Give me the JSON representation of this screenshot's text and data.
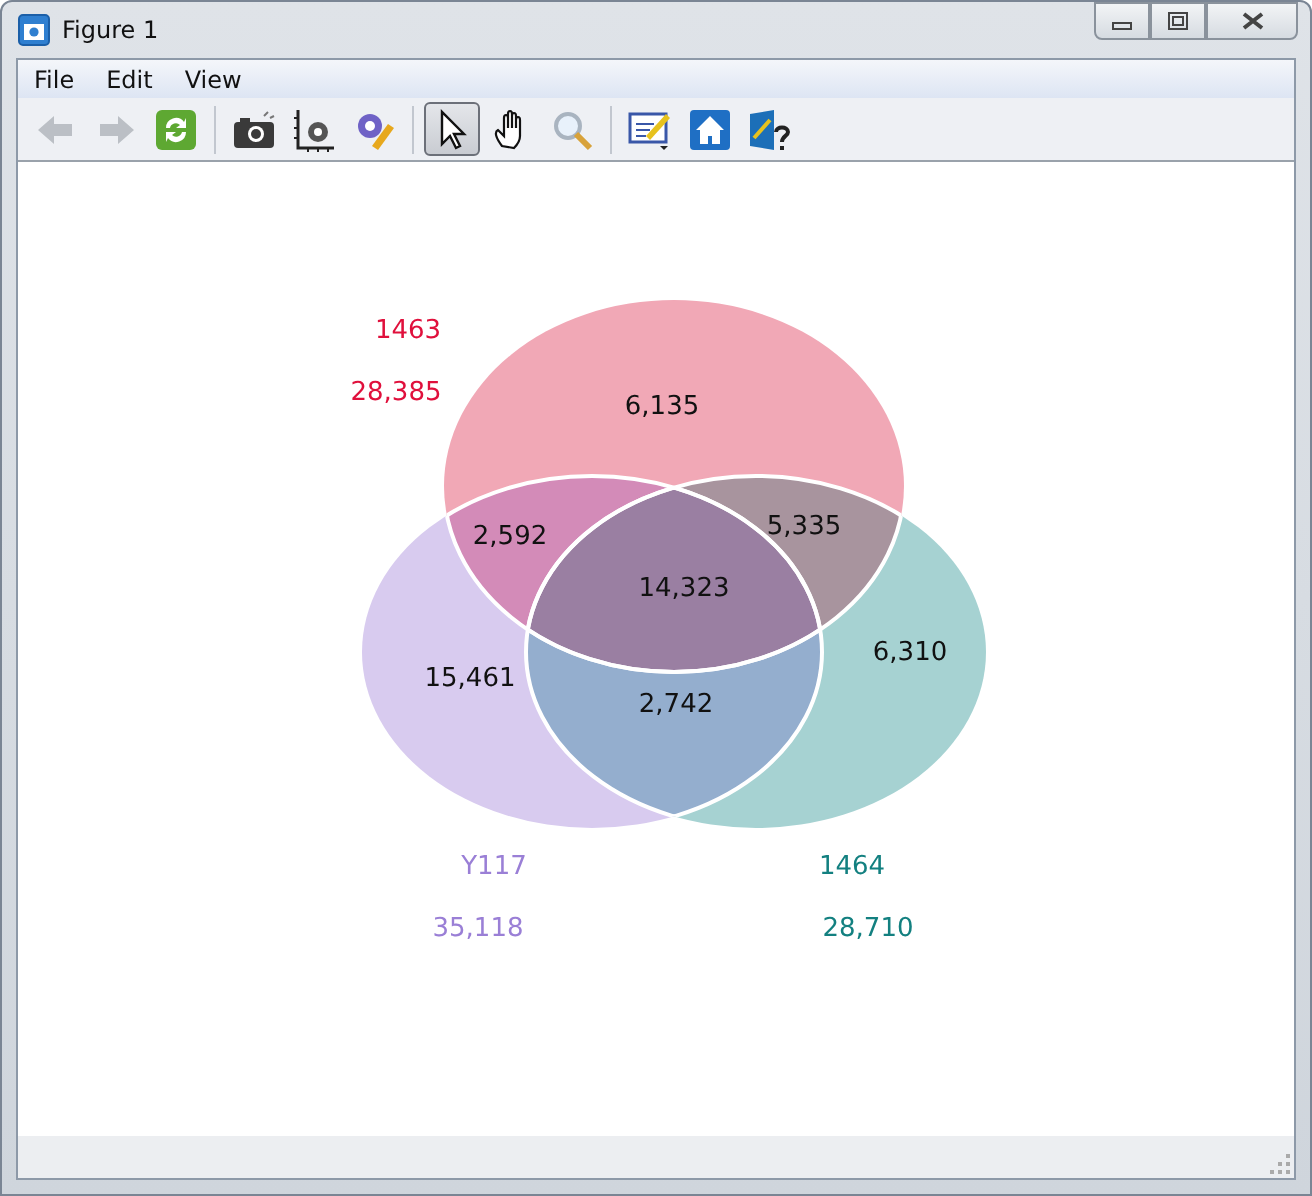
{
  "window": {
    "title": "Figure 1"
  },
  "menu": [
    "File",
    "Edit",
    "View"
  ],
  "toolbar": [
    {
      "kind": "back",
      "selected": false,
      "disabled": true
    },
    {
      "kind": "forward",
      "selected": false,
      "disabled": true
    },
    {
      "kind": "refresh",
      "selected": false,
      "disabled": false
    },
    {
      "kind": "sep"
    },
    {
      "kind": "camera",
      "selected": false,
      "disabled": false
    },
    {
      "kind": "axes",
      "selected": false,
      "disabled": false
    },
    {
      "kind": "wrench",
      "selected": false,
      "disabled": false
    },
    {
      "kind": "sep"
    },
    {
      "kind": "pointer",
      "selected": true,
      "disabled": false
    },
    {
      "kind": "hand",
      "selected": false,
      "disabled": false
    },
    {
      "kind": "zoom",
      "selected": false,
      "disabled": false
    },
    {
      "kind": "sep"
    },
    {
      "kind": "edit",
      "selected": false,
      "disabled": false
    },
    {
      "kind": "home",
      "selected": false,
      "disabled": false
    },
    {
      "kind": "help",
      "selected": false,
      "disabled": false
    }
  ],
  "venn": {
    "sets": [
      {
        "name": "1463",
        "total": "28,385",
        "color": "#e0103c"
      },
      {
        "name": "Y117",
        "total": "35,118",
        "color": "#9a7fd6"
      },
      {
        "name": "1464",
        "total": "28,710",
        "color": "#138080"
      }
    ],
    "regions": [
      {
        "count": "6,135"
      },
      {
        "count": "2,592"
      },
      {
        "count": "5,335"
      },
      {
        "count": "14,323"
      },
      {
        "count": "15,461"
      },
      {
        "count": "2,742"
      },
      {
        "count": "6,310"
      }
    ]
  }
}
